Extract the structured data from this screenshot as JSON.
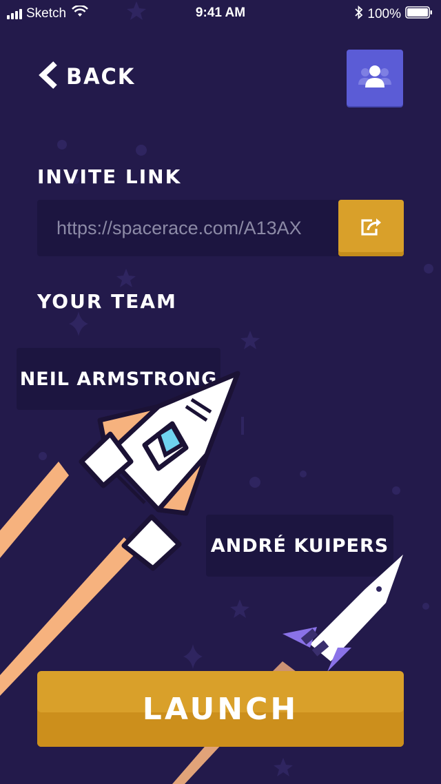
{
  "status_bar": {
    "carrier": "Sketch",
    "time": "9:41 AM",
    "battery_percent": "100%",
    "icons": [
      "signal-icon",
      "wifi-icon",
      "bluetooth-icon",
      "battery-icon"
    ]
  },
  "header": {
    "back_label": "BACK",
    "back_icon": "chevron-left-icon",
    "team_icon": "users-icon"
  },
  "invite": {
    "title": "INVITE LINK",
    "link": "https://spacerace.com/A13AX",
    "share_icon": "share-icon"
  },
  "team": {
    "title": "YOUR TEAM",
    "members": [
      {
        "name": "NEIL ARMSTRONG"
      },
      {
        "name": "ANDRÉ KUIPERS"
      }
    ]
  },
  "launch": {
    "label": "LAUNCH"
  },
  "colors": {
    "background": "#231a4b",
    "card": "#1c1540",
    "accent": "#d9a02a",
    "team_button": "#5b5cd6",
    "rocket_purple": "#8a72e8",
    "flame": "#f6b27e"
  }
}
